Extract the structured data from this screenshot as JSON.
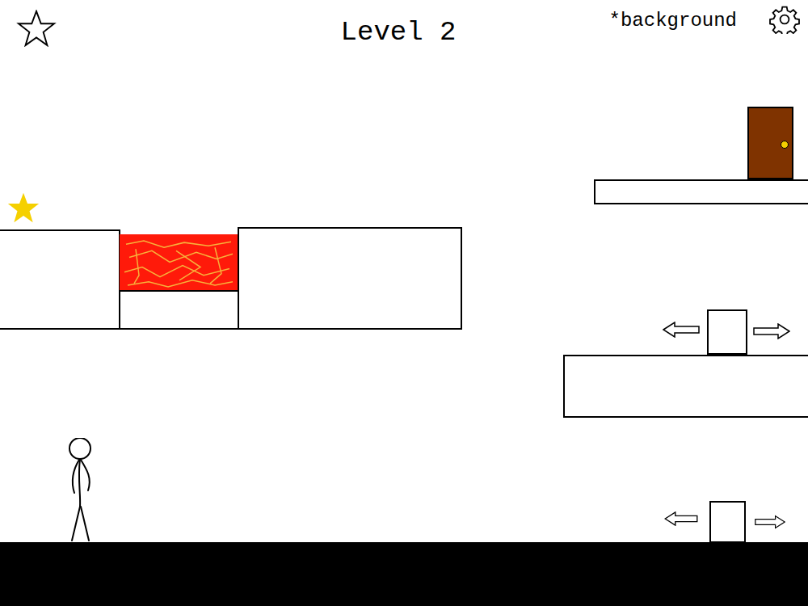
{
  "hud": {
    "title": "Level 2",
    "background_button": "*background",
    "star_collected": false
  }
}
